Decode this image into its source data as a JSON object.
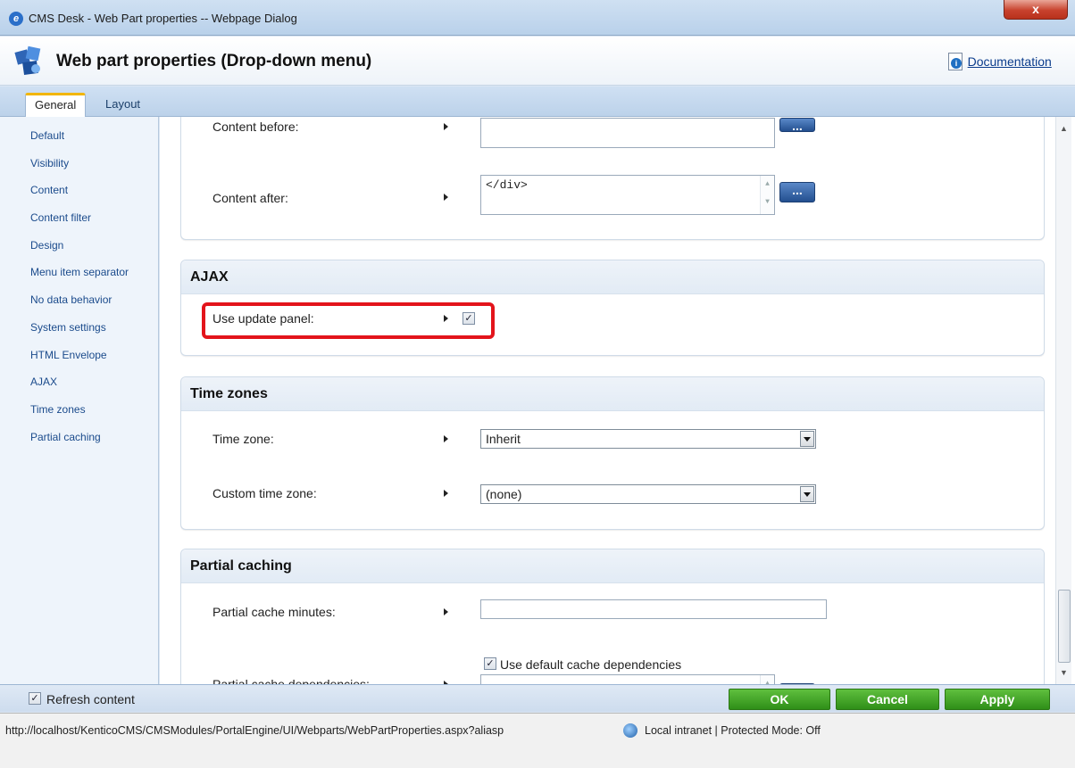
{
  "window": {
    "title": "CMS Desk - Web Part properties -- Webpage Dialog",
    "close_label": "x"
  },
  "header": {
    "title": "Web part properties (Drop-down menu)",
    "documentation_label": "Documentation"
  },
  "tabs": [
    {
      "label": "General",
      "active": true
    },
    {
      "label": "Layout",
      "active": false
    }
  ],
  "sidebar": {
    "items": [
      {
        "label": "Default"
      },
      {
        "label": "Visibility"
      },
      {
        "label": "Content"
      },
      {
        "label": "Content filter"
      },
      {
        "label": "Design"
      },
      {
        "label": "Menu item separator"
      },
      {
        "label": "No data behavior"
      },
      {
        "label": "System settings"
      },
      {
        "label": "HTML Envelope"
      },
      {
        "label": "AJAX"
      },
      {
        "label": "Time zones"
      },
      {
        "label": "Partial caching"
      }
    ]
  },
  "html_envelope": {
    "content_before_label": "Content before:",
    "content_before_value": "",
    "content_after_label": "Content after:",
    "content_after_value": "</div>",
    "ellipsis_label": "..."
  },
  "ajax": {
    "title": "AJAX",
    "use_update_panel_label": "Use update panel:",
    "use_update_panel_checked": true
  },
  "time_zones": {
    "title": "Time zones",
    "time_zone_label": "Time zone:",
    "time_zone_value": "Inherit",
    "custom_time_zone_label": "Custom time zone:",
    "custom_time_zone_value": "(none)"
  },
  "partial_caching": {
    "title": "Partial caching",
    "minutes_label": "Partial cache minutes:",
    "minutes_value": "",
    "dependencies_label": "Partial cache dependencies:",
    "use_default_label": "Use default cache dependencies",
    "use_default_checked": true
  },
  "footer": {
    "refresh_label": "Refresh content",
    "refresh_checked": true,
    "ok_label": "OK",
    "cancel_label": "Cancel",
    "apply_label": "Apply"
  },
  "statusbar": {
    "url": "http://localhost/KenticoCMS/CMSModules/PortalEngine/UI/Webparts/WebPartProperties.aspx?aliasp",
    "zone": "Local intranet | Protected Mode: Off"
  },
  "colors": {
    "highlight": "#e3141b",
    "button_green": "#3d9f22",
    "button_blue": "#2d5d9f"
  }
}
